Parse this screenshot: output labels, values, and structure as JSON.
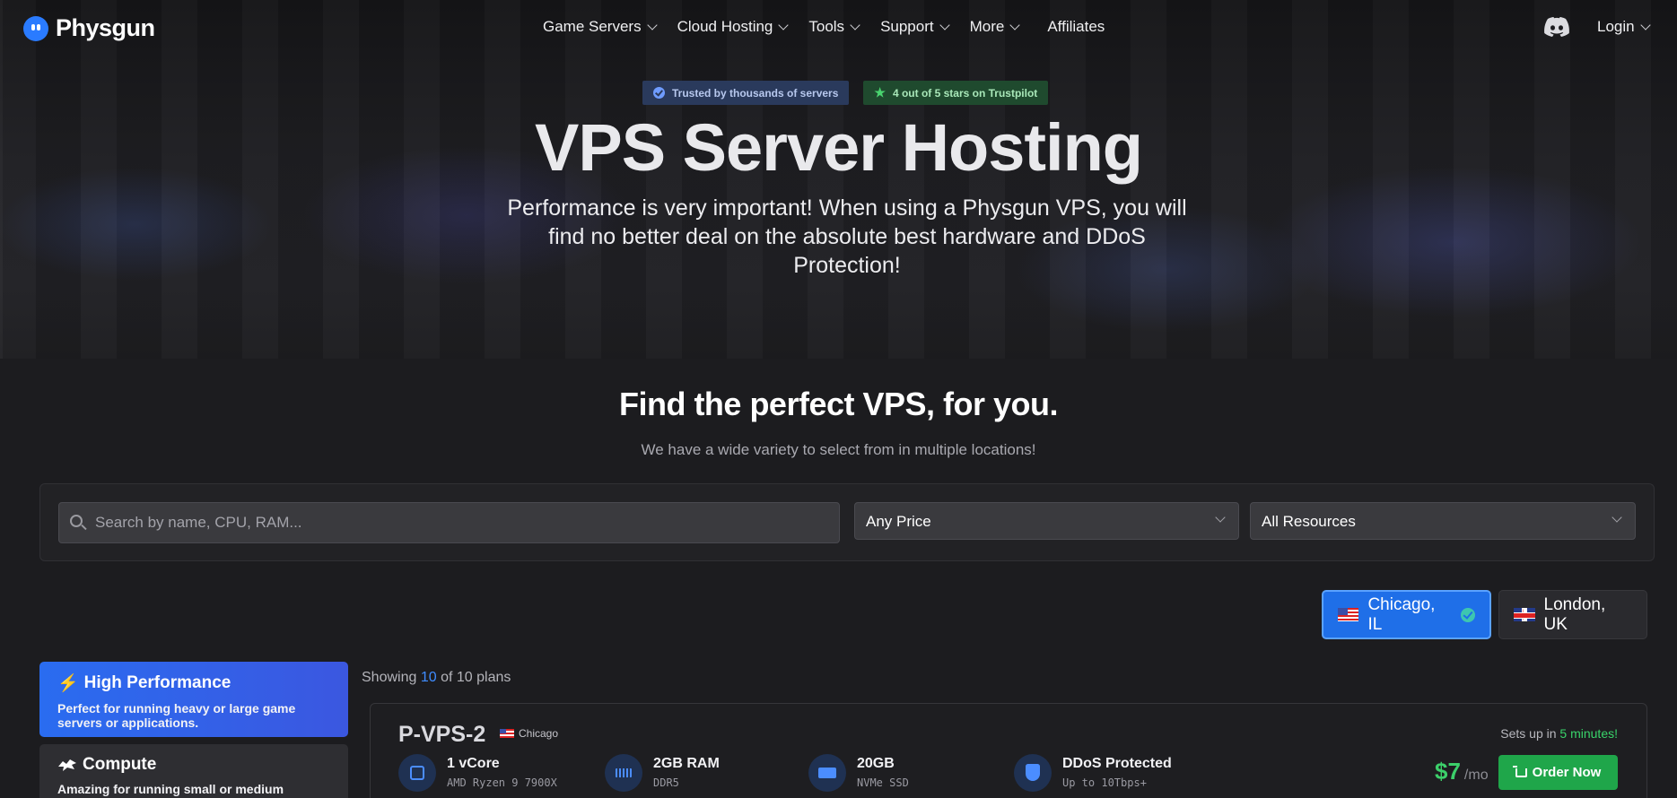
{
  "brand": {
    "name": "Physgun"
  },
  "nav": {
    "items": [
      {
        "label": "Game Servers",
        "dropdown": true
      },
      {
        "label": "Cloud Hosting",
        "dropdown": true
      },
      {
        "label": "Tools",
        "dropdown": true
      },
      {
        "label": "Support",
        "dropdown": true
      },
      {
        "label": "More",
        "dropdown": true
      },
      {
        "label": "Affiliates",
        "dropdown": false
      }
    ],
    "login_label": "Login"
  },
  "badges": {
    "trusted": "Trusted by thousands of servers",
    "trustpilot": "4 out of 5 stars on Trustpilot"
  },
  "hero": {
    "title": "VPS Server Hosting",
    "lead": "Performance is very important! When using a Physgun VPS, you will find no better deal on the absolute best hardware and DDoS Protection!"
  },
  "section": {
    "title": "Find the perfect VPS, for you.",
    "subtitle": "We have a wide variety to select from in multiple locations!"
  },
  "filters": {
    "search_placeholder": "Search by name, CPU, RAM...",
    "price_value": "Any Price",
    "resources_value": "All Resources"
  },
  "locations": [
    {
      "label": "Chicago, IL",
      "active": true
    },
    {
      "label": "London, UK",
      "active": false
    }
  ],
  "categories": [
    {
      "title": "High Performance",
      "desc": "Perfect for running heavy or large game servers or applications."
    },
    {
      "title": "Compute",
      "desc": "Amazing for running small or medium"
    }
  ],
  "showing": {
    "prefix": "Showing",
    "count": "10",
    "suffix": "of 10 plans"
  },
  "plan": {
    "name": "P-VPS-2",
    "location": "Chicago",
    "setup_prefix": "Sets up in",
    "setup_time": "5 minutes!",
    "specs": [
      {
        "title": "1 vCore",
        "detail": "AMD Ryzen 9 7900X"
      },
      {
        "title": "2GB RAM",
        "detail": "DDR5"
      },
      {
        "title": "20GB",
        "detail": "NVMe SSD"
      },
      {
        "title": "DDoS Protected",
        "detail": "Up to 10Tbps+"
      }
    ],
    "price": "$7",
    "per": "/mo",
    "order_label": "Order Now"
  },
  "colors": {
    "accent": "#1f6fe8",
    "success": "#1fa64a",
    "price": "#3ccf6a"
  }
}
